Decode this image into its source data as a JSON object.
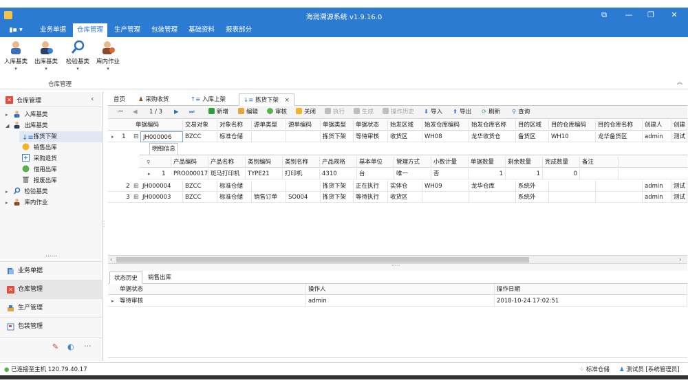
{
  "window": {
    "title": "海润溯源系统 v1.9.16.0"
  },
  "menu": {
    "items": [
      "业务单据",
      "仓库管理",
      "生产管理",
      "包装管理",
      "基础资料",
      "报表部分"
    ],
    "active_index": 1
  },
  "ribbon": {
    "buttons": [
      "入库基类",
      "出库基类",
      "检验基类",
      "库内作业"
    ],
    "group_label": "仓库管理"
  },
  "left_panel": {
    "title": "仓库管理",
    "tree": [
      {
        "label": "入库基类",
        "level": 0,
        "expanded": false
      },
      {
        "label": "出库基类",
        "level": 0,
        "expanded": true
      },
      {
        "label": "拣货下架",
        "level": 1,
        "selected": true
      },
      {
        "label": "销售出库",
        "level": 1
      },
      {
        "label": "采购退货",
        "level": 1
      },
      {
        "label": "借用出库",
        "level": 1
      },
      {
        "label": "报废出库",
        "level": 1
      },
      {
        "label": "检验基类",
        "level": 0,
        "expanded": false
      },
      {
        "label": "库内作业",
        "level": 0,
        "expanded": false
      }
    ],
    "dots": "......",
    "nav": [
      "业务单据",
      "仓库管理",
      "生产管理",
      "包装管理"
    ],
    "nav_active_index": 1,
    "more": "···"
  },
  "tabs": {
    "items": [
      "首页",
      "采购收货",
      "入库上架",
      "拣货下架"
    ],
    "active_index": 3,
    "close": "×"
  },
  "toolbar": {
    "pager": "1 / 3",
    "buttons": [
      {
        "label": "新增",
        "enabled": true,
        "color": "#2e9d3a"
      },
      {
        "label": "编辑",
        "enabled": true,
        "color": "#e7a43a"
      },
      {
        "label": "审核",
        "enabled": true,
        "color": "#5ab04a"
      },
      {
        "label": "关闭",
        "enabled": true,
        "color": "#f0b429"
      },
      {
        "label": "执行",
        "enabled": false,
        "color": "#bdbdbd"
      },
      {
        "label": "生成",
        "enabled": false,
        "color": "#bdbdbd"
      },
      {
        "label": "操作历史",
        "enabled": false,
        "color": "#bdbdbd"
      },
      {
        "label": "导入",
        "enabled": true,
        "color": "#3a7ed8"
      },
      {
        "label": "导出",
        "enabled": true,
        "color": "#3a7ed8"
      },
      {
        "label": "刷新",
        "enabled": true,
        "color": "#3aa34a"
      },
      {
        "label": "查询",
        "enabled": true,
        "color": "#3a7ed8"
      }
    ]
  },
  "main_grid": {
    "columns": [
      "单据编码",
      "交易对象",
      "对象名称",
      "源单类型",
      "源单编码",
      "单据类型",
      "单据状态",
      "始发区域",
      "始发仓库编码",
      "始发仓库名称",
      "目的区域",
      "目的仓库编码",
      "目的仓库名称",
      "创建人",
      "创建"
    ],
    "rows": [
      {
        "num": "1",
        "expander": "⊟",
        "cells": [
          "JH000006",
          "BZCC",
          "标准仓储",
          "",
          "",
          "拣货下架",
          "等待审核",
          "收货区",
          "WH08",
          "龙华收货仓",
          "备货区",
          "WH10",
          "龙华备货区",
          "admin",
          "测试"
        ]
      },
      {
        "num": "2",
        "expander": "⊞",
        "cells": [
          "JH000004",
          "BZCC",
          "标准仓储",
          "",
          "",
          "拣货下架",
          "正在执行",
          "实体仓",
          "WH09",
          "龙华仓库",
          "系统外",
          "",
          "",
          "admin",
          "测试"
        ]
      },
      {
        "num": "3",
        "expander": "⊞",
        "cells": [
          "JH000003",
          "BZCC",
          "标准仓储",
          "销售订单",
          "SO004",
          "拣货下架",
          "等待执行",
          "收货区",
          "",
          "",
          "系统外",
          "",
          "",
          "admin",
          "测试"
        ]
      }
    ],
    "detail": {
      "tab_label": "明细信息",
      "columns": [
        "产品编码",
        "产品名称",
        "类别编码",
        "类别名称",
        "产品规格",
        "基本单位",
        "管理方式",
        "小数计量",
        "单据数量",
        "剩余数量",
        "完成数量",
        "备注"
      ],
      "rows": [
        {
          "num": "1",
          "cells": [
            "PRO000017",
            "斑马打印机",
            "TYPE21",
            "打印机",
            "4310",
            "台",
            "唯一",
            "否",
            "1",
            "1",
            "0",
            ""
          ]
        }
      ]
    }
  },
  "bottom": {
    "tabs": [
      "状态历史",
      "销售出库"
    ],
    "active_index": 0,
    "columns": [
      "单据状态",
      "操作人",
      "操作日期"
    ],
    "rows": [
      {
        "cells": [
          "等待审核",
          "admin",
          "2018-10-24 17:02:51"
        ]
      }
    ]
  },
  "statusbar": {
    "connection": "已连接至主机 120.79.40.17",
    "warehouse": "标准仓储",
    "user": "测试员 [系统管理员]"
  }
}
